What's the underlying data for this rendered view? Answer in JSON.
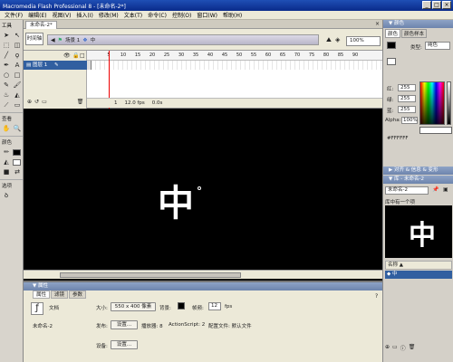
{
  "window": {
    "title": "Macromedia Flash Professional 8 - [未命名-2*]",
    "min": "_",
    "max": "□",
    "close": "×"
  },
  "menubar": [
    "文件(F)",
    "编辑(E)",
    "视图(V)",
    "插入(I)",
    "修改(M)",
    "文本(T)",
    "命令(C)",
    "控制(O)",
    "窗口(W)",
    "帮助(H)"
  ],
  "toolbox": {
    "tools_label": "工具",
    "view_label": "查看",
    "colors_label": "颜色",
    "options_label": "选项",
    "tools": [
      "selection-arrow",
      "subselect-arrow",
      "line",
      "lasso",
      "pen",
      "text",
      "oval",
      "rectangle",
      "pencil",
      "brush",
      "free-transform",
      "fill-transform",
      "ink-bottle",
      "paint-bucket",
      "eyedropper",
      "eraser"
    ]
  },
  "doc_tab": "未命名-2*",
  "editbar": {
    "timeline_button": "时间轴",
    "scene": "场景 1",
    "symbol": "中",
    "zoom": "100%"
  },
  "timeline": {
    "layer_name": "图层 1",
    "frame_ticks": [
      "5",
      "10",
      "15",
      "20",
      "25",
      "30",
      "35",
      "40",
      "45",
      "50",
      "55",
      "60",
      "65",
      "70",
      "75",
      "80",
      "85",
      "90"
    ],
    "frame": "1",
    "fps": "12.0 fps",
    "time": "0.0s"
  },
  "stage": {
    "symbol_text": "中"
  },
  "properties": {
    "header": "▼ 属性",
    "tabs": [
      "属性",
      "滤镜",
      "参数"
    ],
    "doc_type": "文档",
    "doc_name": "未命名-2",
    "size_label": "大小:",
    "size_value": "550 x 400 像素",
    "bg_label": "背景:",
    "fps_label": "帧频:",
    "fps_value": "12",
    "fps_unit": "fps",
    "publish_label": "发布:",
    "settings_button": "设置...",
    "player_label": "播放器: 8",
    "actionscript_label": "ActionScript: 2",
    "profile_label": "配置文件: 默认文件",
    "device_label": "设备:",
    "device_button": "设置..."
  },
  "color_mixer": {
    "header": "颜色",
    "tab2": "颜色样本",
    "type_label": "类型:",
    "type_value": "纯色",
    "r_label": "红:",
    "r_value": "255",
    "g_label": "绿:",
    "g_value": "255",
    "b_label": "蓝:",
    "b_value": "255",
    "alpha_label": "Alpha:",
    "alpha_value": "100%",
    "hex": "#FFFFFF"
  },
  "align_panel": "▶ 对齐 & 信息 & 变形",
  "library": {
    "header": "库 - 未命名-2",
    "doc_select": "未命名-2",
    "item_count": "库中有一个项",
    "item_name": "中",
    "preview_glyph": "中"
  },
  "colors": {
    "stage_bg": "#000000",
    "title_bar": "#1f4fb5",
    "panel_header": "#7d92b8",
    "playhead": "#ee0000"
  }
}
